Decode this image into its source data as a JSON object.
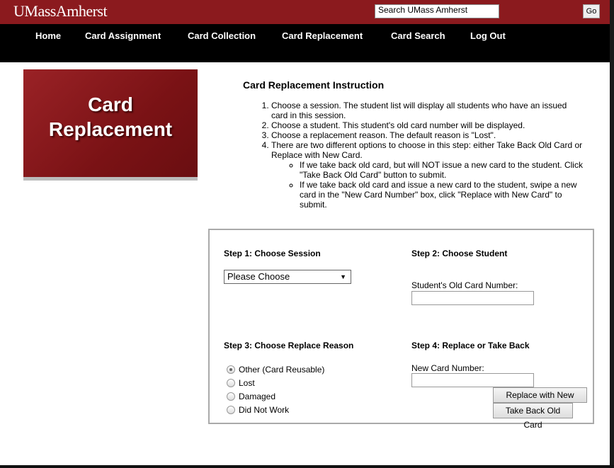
{
  "header": {
    "logo": "UMassAmherst",
    "search_value": "Search UMass Amherst",
    "go_label": "Go"
  },
  "nav": {
    "home": "Home",
    "card_assignment": "Card Assignment",
    "card_collection": "Card Collection",
    "card_replacement": "Card Replacement",
    "card_search": "Card Search",
    "log_out": "Log Out"
  },
  "hero": {
    "line1": "Card",
    "line2": "Replacement"
  },
  "instructions": {
    "title": "Card Replacement Instruction",
    "steps": [
      "Choose a session. The student list will display all students who have an issued card in this session.",
      "Choose a student. This student's old card number will be displayed.",
      "Choose a replacement reason. The default reason is \"Lost\".",
      "There are two different options to choose in this step: either Take Back Old Card or Replace with New Card."
    ],
    "sub_steps": [
      "If we take back old card, but will NOT issue a new card to the student. Click \"Take Back Old Card\" button to submit.",
      "If we take back old card and issue a new card to the student, swipe a new card in the \"New Card Number\" box, click \"Replace with New Card\" to submit."
    ]
  },
  "form": {
    "step1_title": "Step 1: Choose Session",
    "session_selected": "Please Choose",
    "step2_title": "Step 2: Choose Student",
    "old_card_label": "Student's Old Card Number:",
    "old_card_value": "",
    "step3_title": "Step 3: Choose Replace Reason",
    "reasons": [
      {
        "label": "Other (Card Reusable)",
        "checked": true
      },
      {
        "label": "Lost",
        "checked": false
      },
      {
        "label": "Damaged",
        "checked": false
      },
      {
        "label": "Did Not Work",
        "checked": false
      }
    ],
    "step4_title": "Step 4: Replace or Take Back",
    "new_card_label": "New Card Number:",
    "new_card_value": "",
    "replace_label": "Replace with New Card",
    "takeback_label": "Take Back Old Card"
  },
  "colors": {
    "brand": "#8b1a1e",
    "nav_bg": "#000000"
  }
}
